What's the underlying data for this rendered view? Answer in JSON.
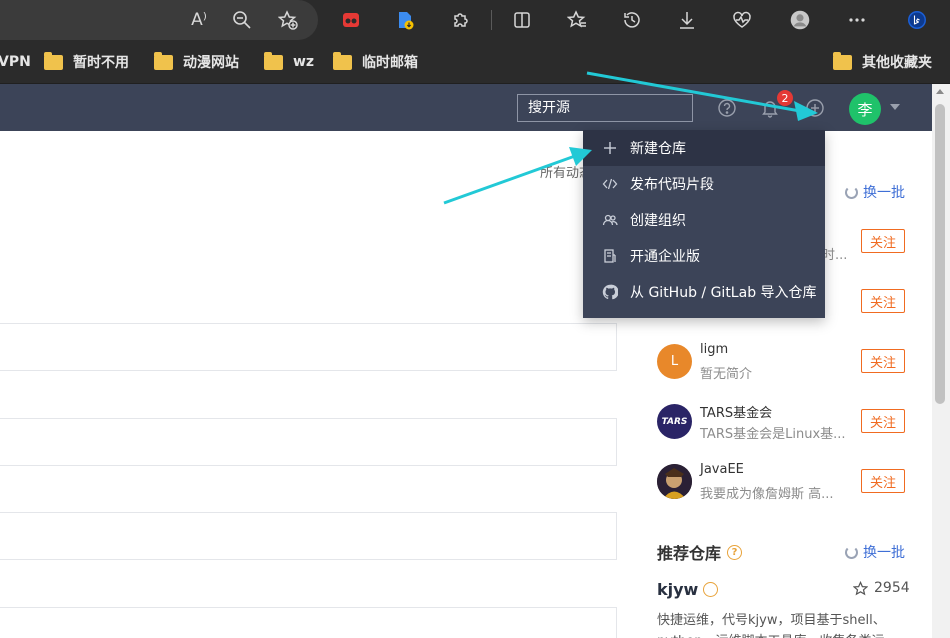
{
  "browser": {
    "toolbar_icons": [
      "read-aloud-icon",
      "zoom-out-icon",
      "add-favorite-icon",
      "extension-red-icon",
      "pdf-download-icon",
      "extensions-icon",
      "split-screen-icon",
      "favorites-icon",
      "history-icon",
      "downloads-icon",
      "browser-essentials-icon",
      "profile-icon",
      "more-icon",
      "bing-copilot-icon"
    ],
    "read_aloud_glyph": "A⁾"
  },
  "bookmarks": [
    {
      "label": "VPN"
    },
    {
      "label": "暂时不用"
    },
    {
      "label": "动漫网站"
    },
    {
      "label": "wz"
    },
    {
      "label": "临时邮箱"
    },
    {
      "label": "其他收藏夹"
    }
  ],
  "header": {
    "search_placeholder": "搜开源",
    "notification_count": "2",
    "avatar_text": "李"
  },
  "dropdown": {
    "items": [
      {
        "label": "新建仓库",
        "icon": "plus-icon"
      },
      {
        "label": "发布代码片段",
        "icon": "code-icon"
      },
      {
        "label": "创建组织",
        "icon": "users-icon"
      },
      {
        "label": "开通企业版",
        "icon": "building-icon"
      },
      {
        "label": "从 GitHub / GitLab 导入仓库",
        "icon": "github-icon"
      }
    ]
  },
  "main": {
    "partial_text": "所有动态"
  },
  "sidebar": {
    "refresh_label": "换一批",
    "follow_label": "关注",
    "users": [
      {
        "name": "",
        "desc": "时...",
        "avatar_color": "#ffffff"
      },
      {
        "name": "",
        "desc": "",
        "avatar_color": "#ffffff"
      },
      {
        "name": "ligm",
        "desc": "暂无简介",
        "avatar_text": "L",
        "avatar_color": "#e8882a"
      },
      {
        "name": "TARS基金会",
        "desc": "TARS基金会是Linux基...",
        "avatar_text": "TARS",
        "avatar_color": "#2a2466"
      },
      {
        "name": "JavaEE",
        "desc": "我要成为像詹姆斯 高...",
        "avatar_text": "",
        "avatar_color": "#3a2a2a"
      }
    ],
    "recommended_title": "推荐仓库",
    "recommended_repo": {
      "name": "kjyw",
      "stars": "2954",
      "desc": "快捷运维，代号kjyw，项目基于shell、python，运维脚本工具库，收集各类运"
    }
  },
  "colors": {
    "header_bg": "#3c4458",
    "accent_orange": "#f06b21",
    "link_blue": "#3f6fd6",
    "annotation_cyan": "#22c9d6",
    "badge_red": "#e53935",
    "avatar_green": "#1fc26a"
  }
}
